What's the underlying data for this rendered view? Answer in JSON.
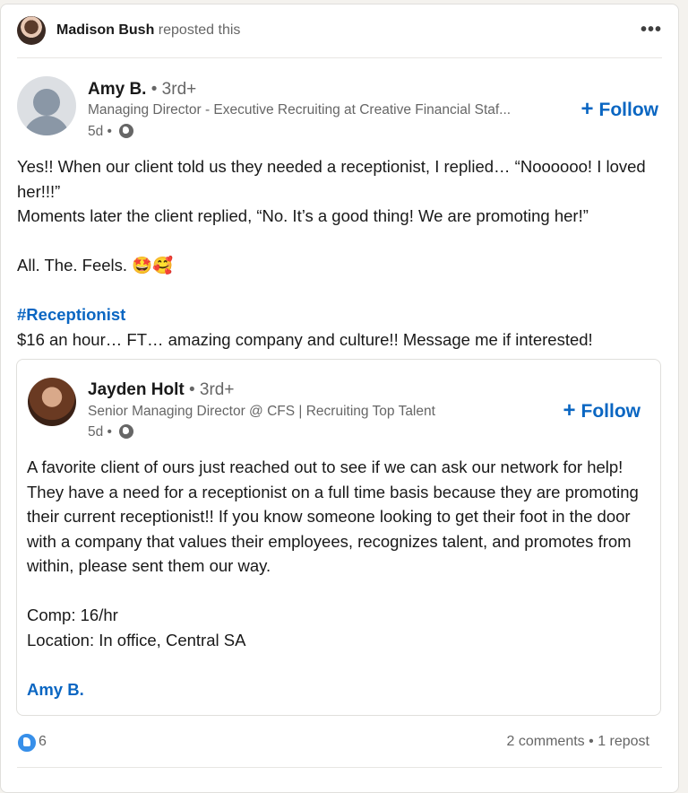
{
  "repost": {
    "name": "Madison Bush",
    "suffix": "reposted this",
    "more_icon": "more-horizontal-icon"
  },
  "author": {
    "name": "Amy B.",
    "degree": "• 3rd+",
    "title": "Managing Director - Executive Recruiting at Creative Financial Staf...",
    "time": "5d •",
    "follow_label": "Follow"
  },
  "post": {
    "lines": [
      "Yes!! When our client told us they needed a receptionist, I replied… “Noooooo! I loved her!!!”",
      "Moments later the client replied, “No. It’s a good thing! We are promoting her!”",
      "",
      "All. The. Feels. 🤩🥰",
      ""
    ],
    "hashtag": "#Receptionist",
    "last_line": "$16 an hour… FT… amazing company and culture!! Message me if interested!"
  },
  "shared": {
    "name": "Jayden Holt",
    "degree": "• 3rd+",
    "title": "Senior Managing Director @ CFS | Recruiting Top Talent",
    "time": "5d •",
    "follow_label": "Follow",
    "paragraph": "A favorite client of ours just reached out to see if we can ask our network for help! They have a need for a receptionist on a full time basis because they are promoting their current receptionist!! If you know someone looking to get their foot in the door with a company that values their employees, recognizes talent, and promotes from within, please sent them our way.",
    "comp": "Comp: 16/hr",
    "location": "Location: In office, Central SA",
    "mention": "Amy B."
  },
  "social": {
    "reaction_count": "6",
    "comments": "2 comments",
    "separator": "•",
    "reposts": "1 repost"
  },
  "colors": {
    "accent": "#0a66c2",
    "muted": "#666666"
  }
}
